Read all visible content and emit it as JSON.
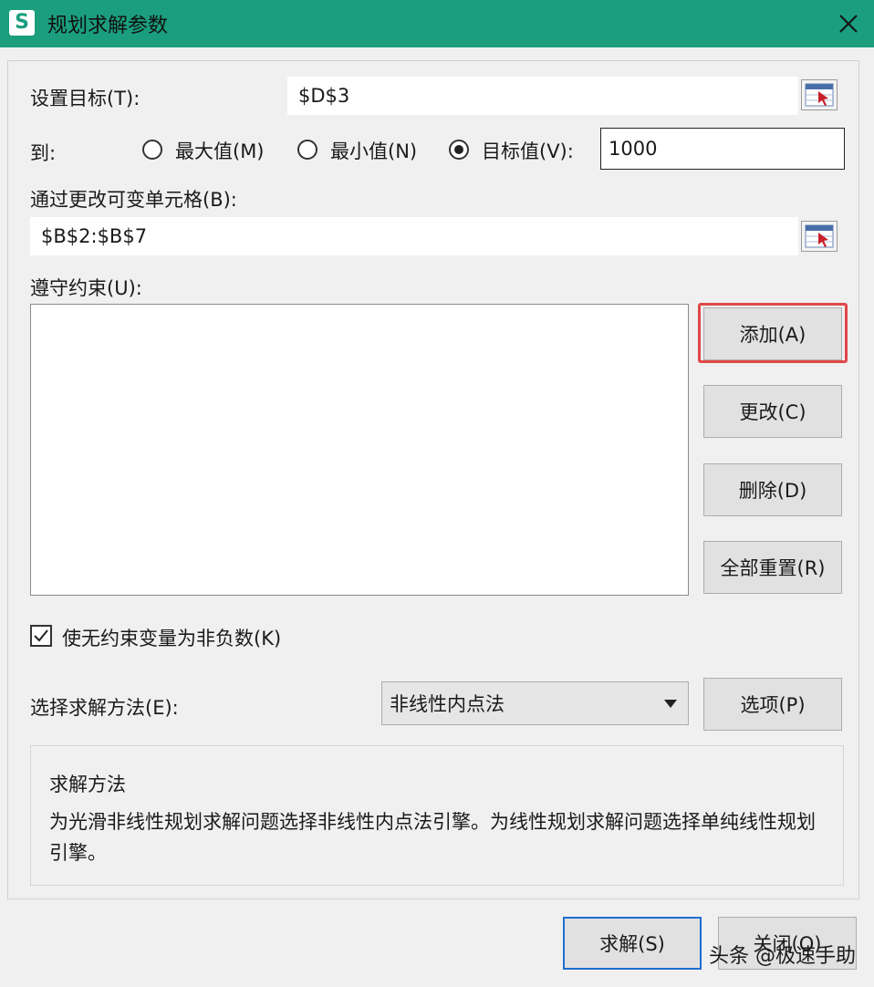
{
  "window": {
    "title": "规划求解参数",
    "app_icon_letter": "S",
    "accent_color": "#1a9e7e"
  },
  "objective": {
    "label": "设置目标(T):",
    "value": "$D$3"
  },
  "to": {
    "label": "到:",
    "options": [
      {
        "label": "最大值(M)",
        "checked": false
      },
      {
        "label": "最小值(N)",
        "checked": false
      },
      {
        "label": "目标值(V):",
        "checked": true
      }
    ],
    "target_value": "1000"
  },
  "changing_cells": {
    "label": "通过更改可变单元格(B):",
    "value": "$B$2:$B$7"
  },
  "constraints": {
    "label": "遵守约束(U):",
    "items": []
  },
  "buttons": {
    "add": "添加(A)",
    "change": "更改(C)",
    "delete": "删除(D)",
    "reset_all": "全部重置(R)",
    "options": "选项(P)",
    "solve": "求解(S)",
    "close": "关闭(O)"
  },
  "nonnegative": {
    "label": "使无约束变量为非负数(K)",
    "checked": true
  },
  "method": {
    "label": "选择求解方法(E):",
    "selected": "非线性内点法"
  },
  "method_info": {
    "title": "求解方法",
    "description": "为光滑非线性规划求解问题选择非线性内点法引擎。为线性规划求解问题选择单纯线性规划引擎。"
  },
  "watermark": "头条 @极速手助"
}
